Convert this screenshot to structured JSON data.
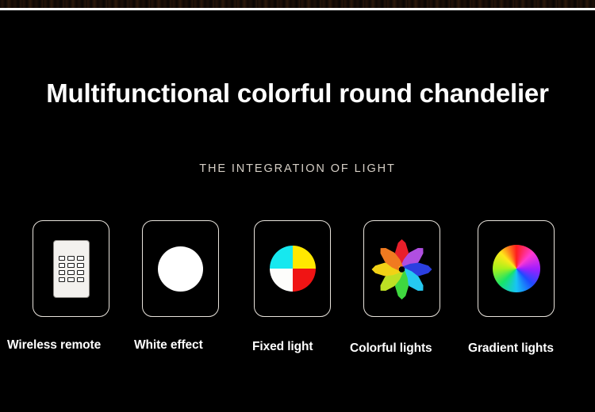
{
  "banner": {
    "headline": "Multifunctional colorful round chandelier",
    "subtitle": "THE INTEGRATION OF LIGHT",
    "background_color": "#000000",
    "headline_color": "#ffffff",
    "subtitle_color": "#d6cfc6",
    "card_border_color": "#e8e3dc",
    "top_strip_color": "#1a0f07",
    "top_hairline_color": "#ffffff"
  },
  "features": [
    {
      "label": "Wireless remote",
      "icon": "remote-control-icon",
      "remote": {
        "body_color": "#f3f1ee",
        "key_rows": 4,
        "key_cols": 3,
        "key_color": "#ffffff",
        "key_border_color": "#1a1a1a"
      }
    },
    {
      "label": "White effect",
      "icon": "white-circle-icon",
      "circle_color": "#ffffff"
    },
    {
      "label": "Fixed light",
      "icon": "quad-color-wheel-icon",
      "quadrants": [
        {
          "position": "top-left",
          "color": "#16e8ef"
        },
        {
          "position": "top-right",
          "color": "#ffe800"
        },
        {
          "position": "bottom-left",
          "color": "#fdfdfb"
        },
        {
          "position": "bottom-right",
          "color": "#f01414"
        }
      ]
    },
    {
      "label": "Colorful lights",
      "icon": "flower-petals-icon",
      "petals": [
        {
          "angle": 0,
          "color": "#e81f2a"
        },
        {
          "angle": 45,
          "color": "#b04fe0"
        },
        {
          "angle": 90,
          "color": "#2b3fe0"
        },
        {
          "angle": 135,
          "color": "#25c8f0"
        },
        {
          "angle": 180,
          "color": "#3fd83f"
        },
        {
          "angle": 225,
          "color": "#bde024"
        },
        {
          "angle": 270,
          "color": "#f2d216"
        },
        {
          "angle": 315,
          "color": "#f07a20"
        }
      ]
    },
    {
      "label": "Gradient lights",
      "icon": "conic-color-wheel-icon",
      "wheel_stops": [
        "#ff1d1d",
        "#ff3ad0",
        "#a21dff",
        "#1d4bff",
        "#17c4f5",
        "#17e36a",
        "#a8f01b",
        "#ffe81a"
      ]
    }
  ]
}
